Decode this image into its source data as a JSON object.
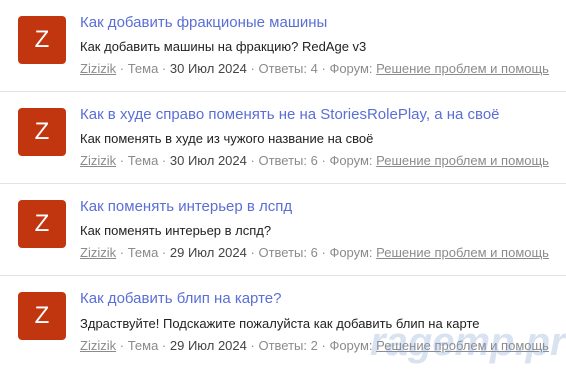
{
  "threads": [
    {
      "avatar_letter": "Z",
      "title": "Как добавить фракционые машины",
      "snippet": "Как добавить машины на фракцию? RedAge v3",
      "author": "Zizizik",
      "type_label": "Тема",
      "date": "30 Июл 2024",
      "replies_label": "Ответы:",
      "replies": "4",
      "forum_label": "Форум:",
      "forum": "Решение проблем и помощь"
    },
    {
      "avatar_letter": "Z",
      "title": "Как в худе справо поменять не на StoriesRolePlay, а на своё",
      "snippet": "Как поменять в худе из чужого название на своё",
      "author": "Zizizik",
      "type_label": "Тема",
      "date": "30 Июл 2024",
      "replies_label": "Ответы:",
      "replies": "6",
      "forum_label": "Форум:",
      "forum": "Решение проблем и помощь"
    },
    {
      "avatar_letter": "Z",
      "title": "Как поменять интерьер в лспд",
      "snippet": "Как поменять интерьер в лспд?",
      "author": "Zizizik",
      "type_label": "Тема",
      "date": "29 Июл 2024",
      "replies_label": "Ответы:",
      "replies": "6",
      "forum_label": "Форум:",
      "forum": "Решение проблем и помощь"
    },
    {
      "avatar_letter": "Z",
      "title": "Как добавить блип на карте?",
      "snippet": "Здраствуйте! Подскажите пожалуйста как добавить блип на карте",
      "author": "Zizizik",
      "type_label": "Тема",
      "date": "29 Июл 2024",
      "replies_label": "Ответы:",
      "replies": "2",
      "forum_label": "Форум:",
      "forum": "Решение проблем и помощь"
    }
  ],
  "watermark": "ragemp.pro",
  "colors": {
    "avatar_bg": "#c1360f",
    "title_link": "#5a6fd6",
    "meta_text": "#8b8b8b"
  }
}
